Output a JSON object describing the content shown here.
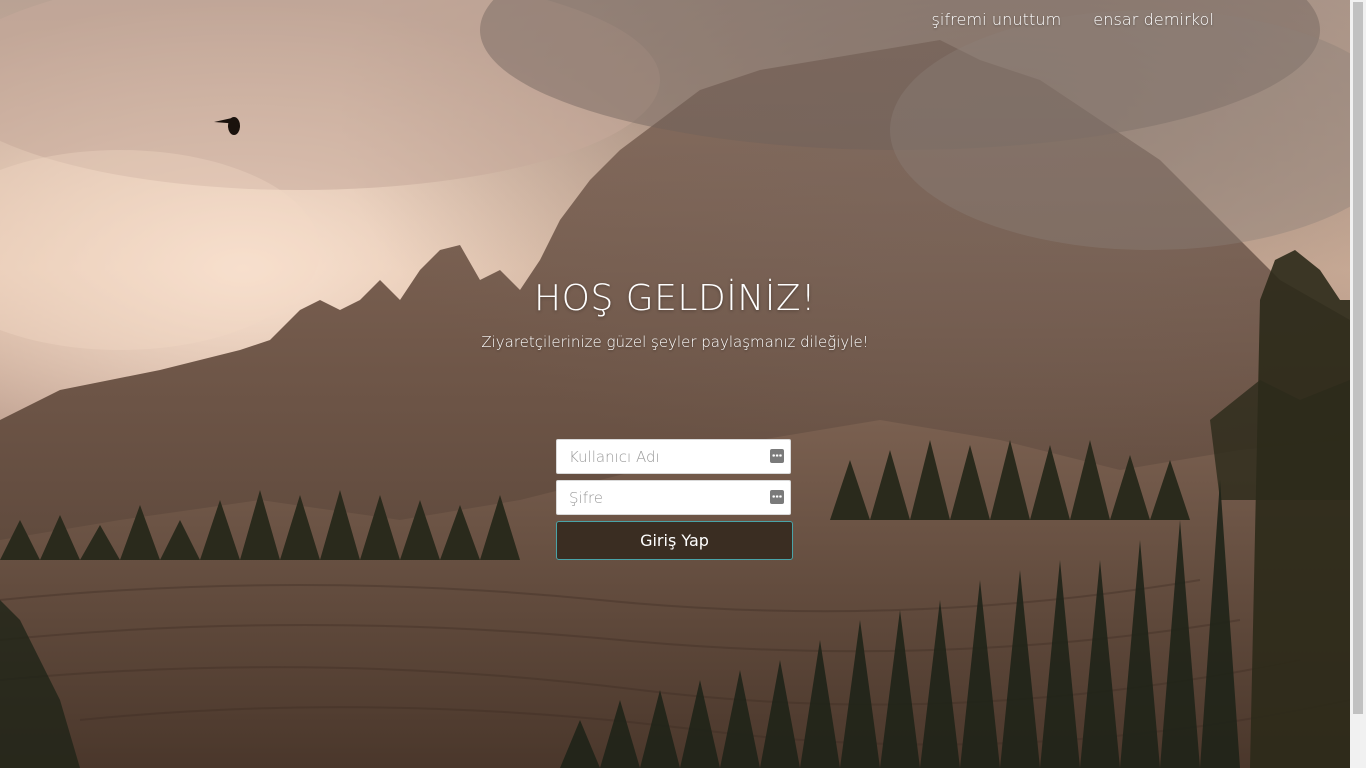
{
  "nav": {
    "forgot_password": "şifremi unuttum",
    "user_name": "ensar demirkol"
  },
  "hero": {
    "title": "HOŞ GELDİNİZ!",
    "subtitle": "Ziyaretçilerinize güzel şeyler paylaşmanız dileğiyle!"
  },
  "form": {
    "username_placeholder": "Kullanıcı Adı",
    "password_placeholder": "Şifre",
    "submit_label": "Giriş Yap"
  },
  "colors": {
    "button_bg": "#3a2d22",
    "button_border": "#49a3a8",
    "text": "#ffffff"
  }
}
